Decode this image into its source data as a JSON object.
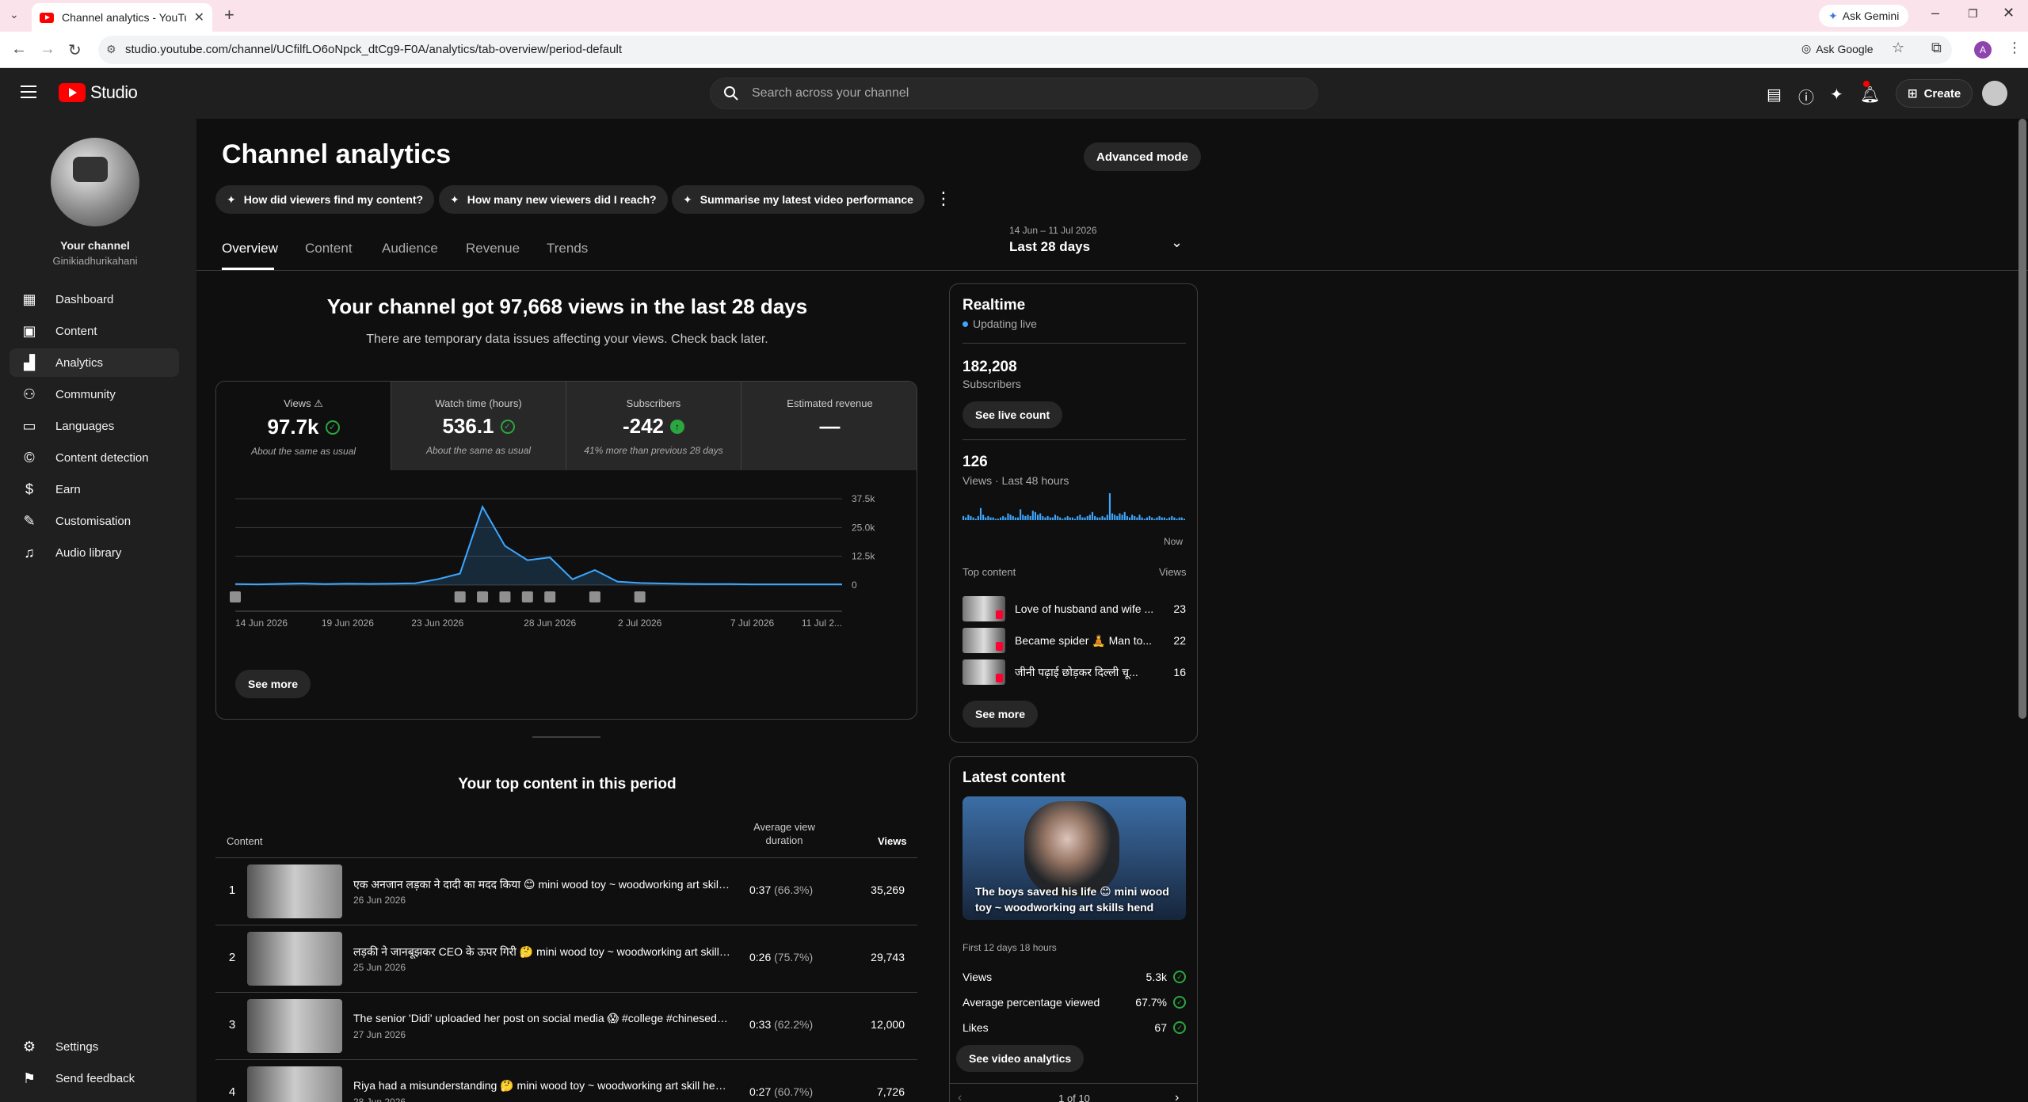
{
  "browser": {
    "tab_title": "Channel analytics - YouTube Studio",
    "url": "studio.youtube.com/channel/UCfilfLO6oNpck_dtCg9-F0A/analytics/tab-overview/period-default",
    "ask_gemini": "Ask Gemini",
    "ask_google": "Ask Google",
    "profile_initial": "A"
  },
  "header": {
    "logo_text": "Studio",
    "search_placeholder": "Search across your channel",
    "create_label": "Create"
  },
  "sidebar": {
    "channel_label": "Your channel",
    "channel_name": "Ginikiadhurikahani",
    "items": [
      {
        "label": "Dashboard",
        "icon": "dashboard-icon",
        "active": false
      },
      {
        "label": "Content",
        "icon": "content-icon",
        "active": false
      },
      {
        "label": "Analytics",
        "icon": "analytics-icon",
        "active": true
      },
      {
        "label": "Community",
        "icon": "community-icon",
        "active": false
      },
      {
        "label": "Languages",
        "icon": "languages-icon",
        "active": false
      },
      {
        "label": "Content detection",
        "icon": "copyright-icon",
        "active": false
      },
      {
        "label": "Earn",
        "icon": "earn-icon",
        "active": false
      },
      {
        "label": "Customisation",
        "icon": "customisation-icon",
        "active": false
      },
      {
        "label": "Audio library",
        "icon": "audio-library-icon",
        "active": false
      }
    ],
    "settings": "Settings",
    "feedback": "Send feedback"
  },
  "main": {
    "title": "Channel analytics",
    "advanced_mode": "Advanced mode",
    "chips": [
      "How did viewers find my content?",
      "How many new viewers did I reach?",
      "Summarise my latest video performance"
    ],
    "tabs": [
      "Overview",
      "Content",
      "Audience",
      "Revenue",
      "Trends"
    ],
    "range_dates": "14 Jun – 11 Jul 2026",
    "range_label": "Last 28 days",
    "headline": "Your channel got 97,668 views in the last 28 days",
    "subline": "There are temporary data issues affecting your views. Check back later.",
    "metrics": [
      {
        "label": "Views",
        "value": "97.7k",
        "note": "About the same as usual"
      },
      {
        "label": "Watch time (hours)",
        "value": "536.1",
        "note": "About the same as usual"
      },
      {
        "label": "Subscribers",
        "value": "-242",
        "note": "41% more than previous 28 days"
      },
      {
        "label": "Estimated revenue",
        "value": "—",
        "note": ""
      }
    ],
    "see_more": "See more",
    "top_content_title": "Your top content in this period",
    "table_headers": {
      "content": "Content",
      "avd": "Average view duration",
      "views": "Views"
    },
    "top_content": [
      {
        "rank": "1",
        "title": "एक अनजान लड़का ने दादी का मदद किया 😊 mini wood toy ~ woodworking art skill hend crafts",
        "date": "26 Jun 2026",
        "duration": "0:37",
        "pct": "(66.3%)",
        "views": "35,269"
      },
      {
        "rank": "2",
        "title": "लड़की ने जानबूझकर CEO के ऊपर गिरी 🤔 mini wood toy ~ woodworking art skill hend crafts",
        "date": "25 Jun 2026",
        "duration": "0:26",
        "pct": "(75.7%)",
        "views": "29,743"
      },
      {
        "rank": "3",
        "title": "The senior 'Didi' uploaded her post on social media 😱 #college #chinesedrama",
        "date": "27 Jun 2026",
        "duration": "0:33",
        "pct": "(62.2%)",
        "views": "12,000"
      },
      {
        "rank": "4",
        "title": "Riya had a misunderstanding 🤔 mini wood toy ~ woodworking art skill hend crafts",
        "date": "28 Jun 2026",
        "duration": "0:27",
        "pct": "(60.7%)",
        "views": "7,726"
      }
    ]
  },
  "chart_data": {
    "type": "line",
    "x": [
      "14 Jun 2026",
      "15 Jun 2026",
      "16 Jun 2026",
      "17 Jun 2026",
      "18 Jun 2026",
      "19 Jun 2026",
      "20 Jun 2026",
      "21 Jun 2026",
      "22 Jun 2026",
      "23 Jun 2026",
      "24 Jun 2026",
      "25 Jun 2026",
      "26 Jun 2026",
      "27 Jun 2026",
      "28 Jun 2026",
      "29 Jun 2026",
      "30 Jun 2026",
      "1 Jul 2026",
      "2 Jul 2026",
      "3 Jul 2026",
      "4 Jul 2026",
      "5 Jul 2026",
      "6 Jul 2026",
      "7 Jul 2026",
      "8 Jul 2026",
      "9 Jul 2026",
      "10 Jul 2026",
      "11 Jul 2026"
    ],
    "x_tick_labels": [
      "14 Jun 2026",
      "19 Jun 2026",
      "23 Jun 2026",
      "28 Jun 2026",
      "2 Jul 2026",
      "7 Jul 2026",
      "11 Jul 2..."
    ],
    "series": [
      {
        "values": [
          400,
          300,
          500,
          700,
          400,
          600,
          500,
          600,
          800,
          2500,
          5000,
          34000,
          17000,
          10800,
          12000,
          2500,
          6500,
          1500,
          900,
          700,
          500,
          400,
          400,
          300,
          300,
          300,
          300,
          300
        ]
      }
    ],
    "y_ticks": [
      "0",
      "12.5k",
      "25.0k",
      "37.5k"
    ],
    "ylim": [
      0,
      37500
    ],
    "line_color": "#3ea6ff",
    "video_markers_days": [
      0,
      10,
      11,
      12,
      13,
      14,
      16,
      18
    ]
  },
  "realtime": {
    "title": "Realtime",
    "status": "Updating live",
    "subscribers": "182,208",
    "subscribers_label": "Subscribers",
    "see_live_count": "See live count",
    "views": "126",
    "views_label": "Views · Last 48 hours",
    "now_label": "Now",
    "bars": [
      3,
      2,
      4,
      3,
      2,
      1,
      3,
      9,
      4,
      2,
      3,
      2,
      2,
      1,
      1,
      2,
      3,
      2,
      5,
      4,
      3,
      2,
      2,
      8,
      4,
      3,
      4,
      3,
      7,
      6,
      4,
      5,
      3,
      2,
      3,
      2,
      2,
      4,
      3,
      2,
      1,
      2,
      3,
      2,
      2,
      1,
      3,
      4,
      2,
      2,
      3,
      4,
      6,
      3,
      2,
      2,
      3,
      2,
      4,
      20,
      5,
      4,
      3,
      5,
      4,
      6,
      3,
      2,
      4,
      3,
      2,
      4,
      2,
      1,
      2,
      3,
      2,
      1,
      2,
      3,
      2,
      2,
      1,
      2,
      3,
      2,
      1,
      2,
      2,
      1
    ],
    "top_content_label": "Top content",
    "views_header": "Views",
    "items": [
      {
        "title": "Love of husband and wife ...",
        "views": "23"
      },
      {
        "title": "Became spider 🧘 Man to...",
        "views": "22"
      },
      {
        "title": "जीनी पढ़ाई छोड़कर दिल्ली चू...",
        "views": "16"
      }
    ],
    "see_more": "See more"
  },
  "latest": {
    "title": "Latest content",
    "video_title": "The boys saved his life 😊 mini wood toy ~ woodworking art skills hend cra...",
    "age": "First 12 days 18 hours",
    "rows": [
      {
        "label": "Views",
        "value": "5.3k"
      },
      {
        "label": "Average percentage viewed",
        "value": "67.7%"
      },
      {
        "label": "Likes",
        "value": "67"
      }
    ],
    "see_analytics": "See video analytics",
    "pager": "1 of 10"
  }
}
